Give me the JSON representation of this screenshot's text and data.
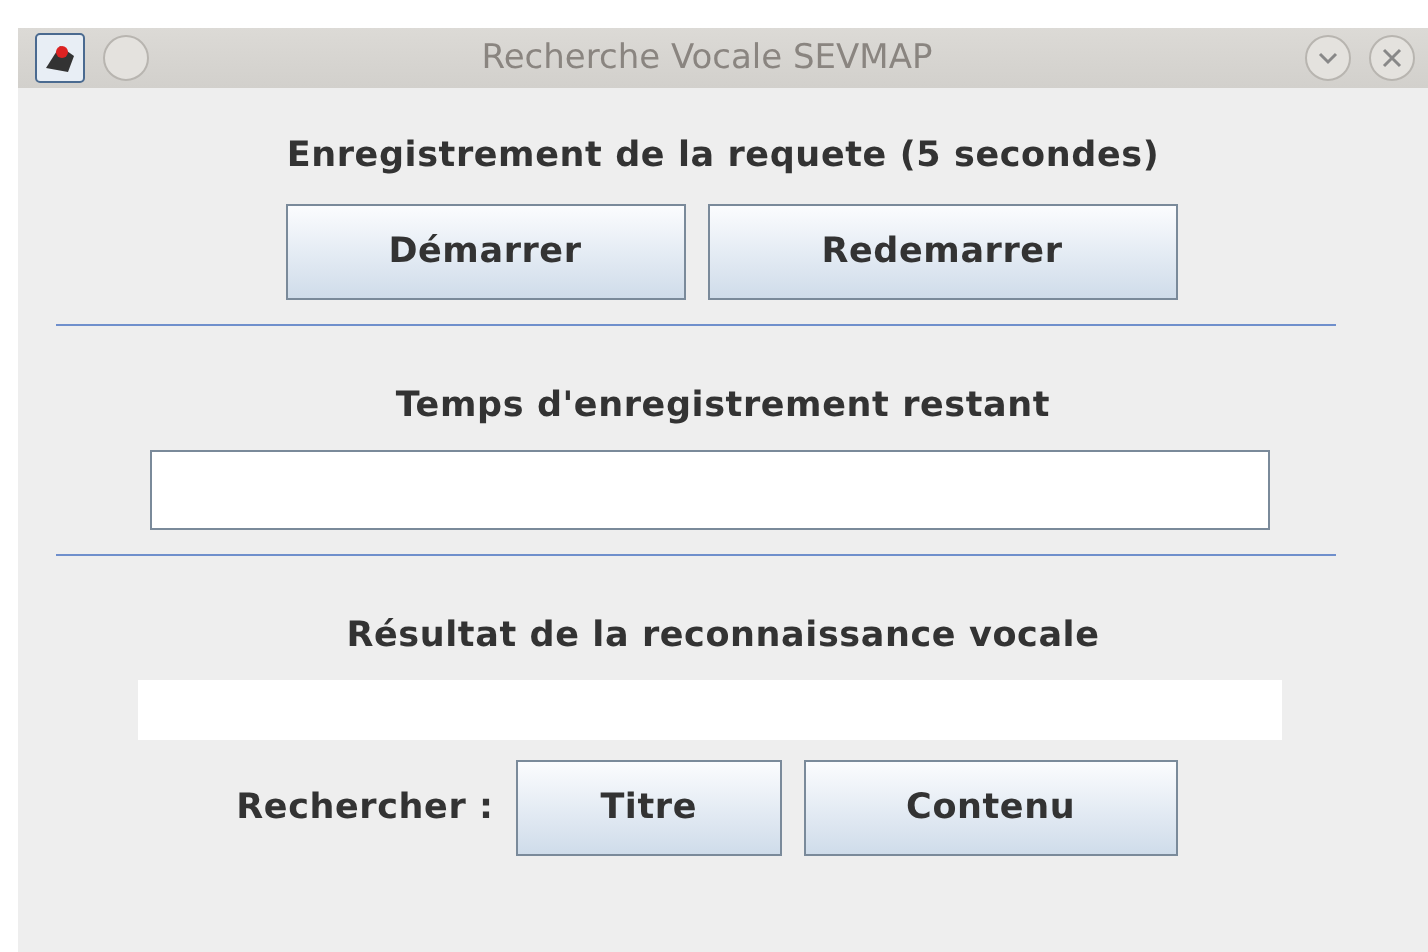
{
  "window": {
    "title": "Recherche Vocale SEVMAP"
  },
  "recording": {
    "heading": "Enregistrement de la requete (5 secondes)",
    "buttons": [
      "Démarrer",
      "Redemarrer"
    ]
  },
  "remaining": {
    "label": "Temps d'enregistrement restant"
  },
  "result": {
    "label": "Résultat de la reconnaissance vocale"
  },
  "search": {
    "label": "Rechercher :",
    "buttons": [
      "Titre",
      "Contenu"
    ]
  }
}
